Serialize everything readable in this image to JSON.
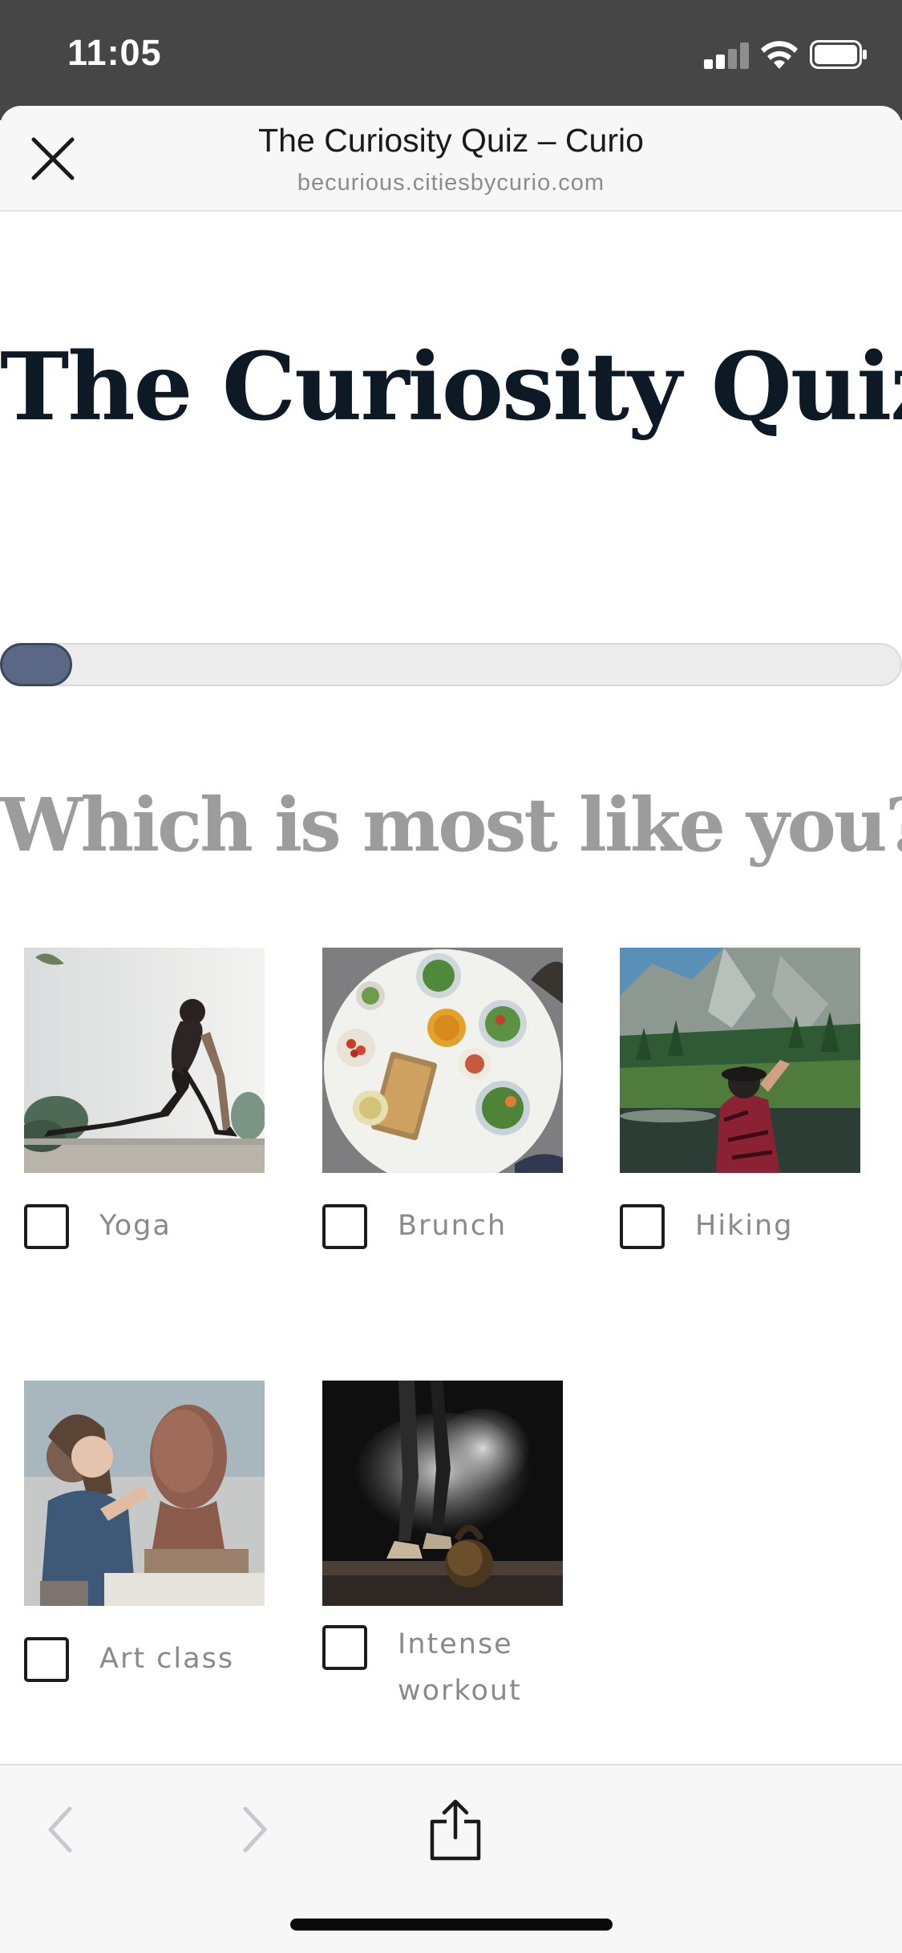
{
  "status_bar": {
    "time": "11:05"
  },
  "browser": {
    "title": "The Curiosity Quiz – Curio",
    "url": "becurious.citiesbycurio.com"
  },
  "page": {
    "heading": "The Curiosity Quiz",
    "progress_fraction": 0.08,
    "question": "Which is most like you?",
    "options": [
      {
        "label": "Yoga",
        "checked": false
      },
      {
        "label": "Brunch",
        "checked": false
      },
      {
        "label": "Hiking",
        "checked": false
      },
      {
        "label": "Art class",
        "checked": false
      },
      {
        "label": "Intense workout",
        "checked": false
      }
    ]
  },
  "toolbar": {
    "back_icon": "chevron-left-icon",
    "forward_icon": "chevron-right-icon",
    "share_icon": "share-icon"
  },
  "colors": {
    "status_bar_bg": "#464646",
    "heading": "#0d1a26",
    "question": "#9c9c9c",
    "progress_fill": "#5a6885"
  }
}
